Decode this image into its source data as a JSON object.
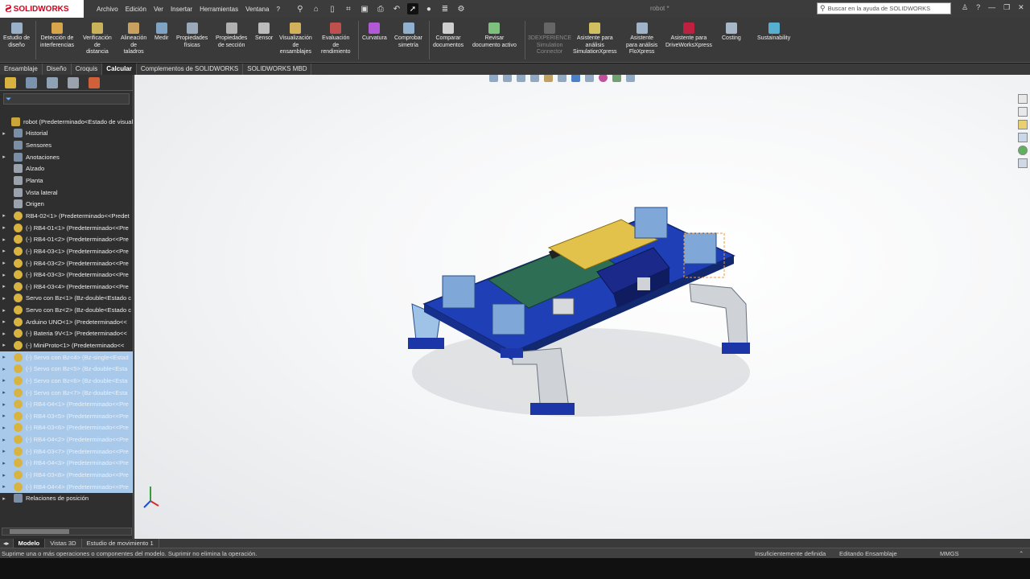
{
  "app": {
    "brand": "SOLIDWORKS",
    "doc_title": "robot *",
    "menus": [
      "Archivo",
      "Edición",
      "Ver",
      "Insertar",
      "Herramientas",
      "Ventana",
      "?"
    ],
    "search_placeholder": "Buscar en la ayuda de SOLIDWORKS"
  },
  "command_manager": [
    {
      "label": "Estudio de\ndiseño",
      "color": "#9ab0c8"
    },
    {
      "label": "Detección de\ninterferencias",
      "color": "#d9a54a"
    },
    {
      "label": "Verificación\nde\ndistancia",
      "color": "#c9b25a"
    },
    {
      "label": "Alineación\nde\ntaladros",
      "color": "#c8a060"
    },
    {
      "label": "Medir",
      "color": "#7fa3c2"
    },
    {
      "label": "Propiedades\nfísicas",
      "color": "#9aa9b9"
    },
    {
      "label": "Propiedades\nde sección",
      "color": "#b0b0b0"
    },
    {
      "label": "Sensor",
      "color": "#bbbbbb"
    },
    {
      "label": "Visualización\nde\nensamblajes",
      "color": "#d3b15a"
    },
    {
      "label": "Evaluación\nde\nrendimiento",
      "color": "#c0504d"
    },
    {
      "label": "Curvatura",
      "color": "#b25ad6"
    },
    {
      "label": "Comprobar\nsimetría",
      "color": "#8fb0cf"
    },
    {
      "label": "Comparar\ndocumentos",
      "color": "#cfcfcf"
    },
    {
      "label": "Revisar\ndocumento activo",
      "color": "#7ec07e"
    },
    {
      "label": "3DEXPERIENCE\nSimulation\nConnector",
      "color": "#666666",
      "dim": true
    },
    {
      "label": "Asistente para\nanálisis\nSimulationXpress",
      "color": "#d0c060"
    },
    {
      "label": "Asistente\npara análisis\nFloXpress",
      "color": "#9fb3c9"
    },
    {
      "label": "Asistente para\nDriveWorksXpress",
      "color": "#c02040"
    },
    {
      "label": "Costing",
      "color": "#a8b7c7"
    },
    {
      "label": "Sustainability",
      "color": "#58b0d0"
    }
  ],
  "tabs": [
    "Ensamblaje",
    "Diseño",
    "Croquis",
    "Calcular",
    "Complementos de SOLIDWORKS",
    "SOLIDWORKS MBD"
  ],
  "active_tab": "Calcular",
  "feature_tree": [
    {
      "label": "robot  (Predeterminado<Estado de visualiz",
      "icon": "root",
      "arrow": ""
    },
    {
      "label": "Historial",
      "icon": "folder",
      "arrow": "▸"
    },
    {
      "label": "Sensores",
      "icon": "folder",
      "arrow": ""
    },
    {
      "label": "Anotaciones",
      "icon": "folder",
      "arrow": "▸"
    },
    {
      "label": "Alzado",
      "icon": "plane",
      "arrow": ""
    },
    {
      "label": "Planta",
      "icon": "plane",
      "arrow": ""
    },
    {
      "label": "Vista lateral",
      "icon": "plane",
      "arrow": ""
    },
    {
      "label": "Origen",
      "icon": "plane",
      "arrow": ""
    },
    {
      "label": "RB4-02<1> (Predeterminado<<Predet",
      "icon": "part",
      "arrow": "▸"
    },
    {
      "label": "(-) RB4-01<1> (Predeterminado<<Pre",
      "icon": "part",
      "arrow": "▸"
    },
    {
      "label": "(-) RB4-01<2> (Predeterminado<<Pre",
      "icon": "part",
      "arrow": "▸"
    },
    {
      "label": "(-) RB4-03<1> (Predeterminado<<Pre",
      "icon": "part",
      "arrow": "▸"
    },
    {
      "label": "(-) RB4-03<2> (Predeterminado<<Pre",
      "icon": "part",
      "arrow": "▸"
    },
    {
      "label": "(-) RB4-03<3> (Predeterminado<<Pre",
      "icon": "part",
      "arrow": "▸"
    },
    {
      "label": "(-) RB4-03<4> (Predeterminado<<Pre",
      "icon": "part",
      "arrow": "▸"
    },
    {
      "label": "Servo con Bz<1> (Bz-double<Estado c",
      "icon": "part",
      "arrow": "▸"
    },
    {
      "label": "Servo con Bz<2> (Bz-double<Estado c",
      "icon": "part",
      "arrow": "▸"
    },
    {
      "label": "Arduino UNO<1> (Predeterminado<<",
      "icon": "part",
      "arrow": "▸"
    },
    {
      "label": "(-) Bateria 9V<1> (Predeterminado<<",
      "icon": "part",
      "arrow": "▸"
    },
    {
      "label": "(-) MiniProto<1> (Predeterminado<<",
      "icon": "part",
      "arrow": "▸"
    },
    {
      "label": "(-) Servo con Bz<4> (Bz-single<Estad",
      "icon": "part",
      "arrow": "▸",
      "hl": true
    },
    {
      "label": "(-) Servo con Bz<5> (Bz-double<Esta",
      "icon": "part",
      "arrow": "▸",
      "hl": true
    },
    {
      "label": "(-) Servo con Bz<6> (Bz-double<Esta",
      "icon": "part",
      "arrow": "▸",
      "hl": true
    },
    {
      "label": "(-) Servo con Bz<7> (Bz-double<Esta",
      "icon": "part",
      "arrow": "▸",
      "hl": true
    },
    {
      "label": "(-) RB4-04<1> (Predeterminado<<Pre",
      "icon": "part",
      "arrow": "▸",
      "hl": true
    },
    {
      "label": "(-) RB4-03<5> (Predeterminado<<Pre",
      "icon": "part",
      "arrow": "▸",
      "hl": true
    },
    {
      "label": "(-) RB4-03<6> (Predeterminado<<Pre",
      "icon": "part",
      "arrow": "▸",
      "hl": true
    },
    {
      "label": "(-) RB4-04<2> (Predeterminado<<Pre",
      "icon": "part",
      "arrow": "▸",
      "hl": true
    },
    {
      "label": "(-) RB4-03<7> (Predeterminado<<Pre",
      "icon": "part",
      "arrow": "▸",
      "hl": true
    },
    {
      "label": "(-) RB4-04<3> (Predeterminado<<Pre",
      "icon": "part",
      "arrow": "▸",
      "hl": true
    },
    {
      "label": "(-) RB4-03<8> (Predeterminado<<Pre",
      "icon": "part",
      "arrow": "▸",
      "hl": true
    },
    {
      "label": "(-) RB4-04<4> (Predeterminado<<Pre",
      "icon": "part",
      "arrow": "▸",
      "hl": true
    },
    {
      "label": "Relaciones de posición",
      "icon": "folder",
      "arrow": "▸"
    }
  ],
  "bottom_tabs": [
    "Modelo",
    "Vistas 3D",
    "Estudio de movimiento 1"
  ],
  "active_bottom_tab": "Modelo",
  "status": {
    "message": "Suprime una o más operaciones o componentes del modelo. Suprimir no elimina la operación.",
    "definition": "Insuficientemente definida",
    "mode": "Editando Ensamblaje",
    "units": "MMGS"
  },
  "colors": {
    "accent_blue": "#1f3fb6",
    "selection_blue": "#a9c9ea",
    "brand_red": "#d6001c"
  }
}
